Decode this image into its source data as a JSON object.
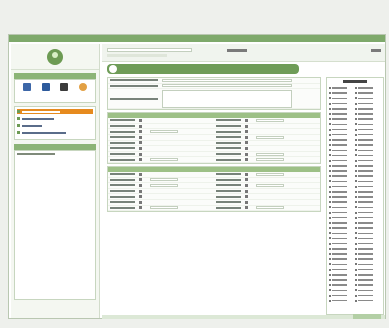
{
  "window": {
    "title": ""
  },
  "left": {
    "panel_title": "",
    "search_title": ""
  },
  "toolbar": {
    "search_placeholder": "",
    "quick_label": ""
  },
  "header": {
    "title": ""
  },
  "right_panel": {
    "title": ""
  },
  "icons": [
    "user-icon",
    "display-icon",
    "edit-icon",
    "printer-icon"
  ],
  "colors": {
    "accent": "#6e9c57",
    "selected": "#e68a1e",
    "panel_head": "#8cb477"
  }
}
